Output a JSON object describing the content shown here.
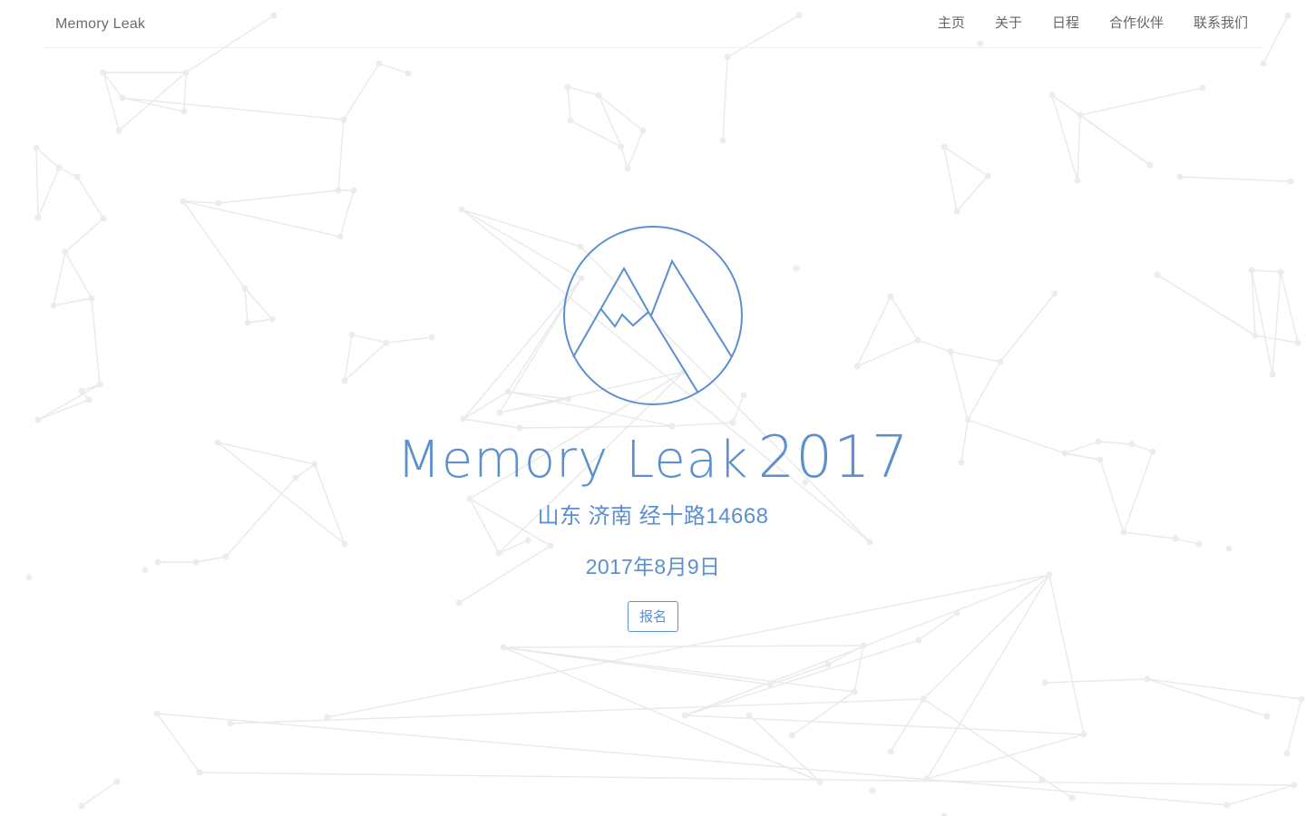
{
  "navbar": {
    "brand": "Memory Leak",
    "links": [
      {
        "label": "主页"
      },
      {
        "label": "关于"
      },
      {
        "label": "日程"
      },
      {
        "label": "合作伙伴"
      },
      {
        "label": "联系我们"
      }
    ]
  },
  "hero": {
    "title": "Memory Leak",
    "year": "2017",
    "location": "山东 济南 经十路14668",
    "date": "2017年8月9日",
    "signup_label": "报名"
  },
  "colors": {
    "accent": "#5b8fcf",
    "nav_text": "#666666",
    "background_network": "#e9e9e9"
  },
  "icons": {
    "logo": "mountain-circle-logo"
  }
}
